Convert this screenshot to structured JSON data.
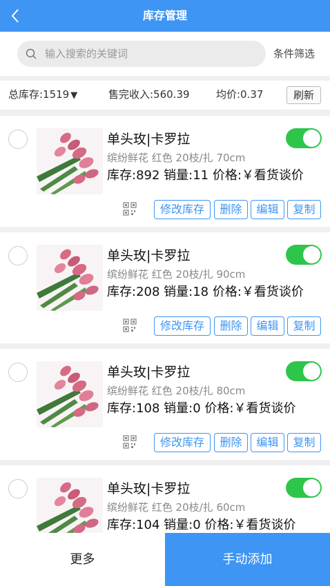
{
  "header": {
    "title": "库存管理",
    "back_icon": "chevron-left-icon"
  },
  "search": {
    "placeholder": "输入搜索的关键词",
    "filter_label": "条件筛选"
  },
  "summary": {
    "total_stock": "总库存:1519",
    "income": "售完收入:560.39",
    "avg_price": "均价:0.37",
    "refresh_label": "刷新"
  },
  "actions": {
    "edit_stock": "修改库存",
    "delete": "删除",
    "edit": "编辑",
    "copy": "复制"
  },
  "items": [
    {
      "name": "单头玫|卡罗拉",
      "attrs": "缤纷鲜花  红色  20枝/扎  70cm",
      "stats": "库存:892 销量:11 价格:￥看货谈价",
      "enabled": true
    },
    {
      "name": "单头玫|卡罗拉",
      "attrs": "缤纷鲜花  红色  20枝/扎  90cm",
      "stats": "库存:208 销量:18 价格:￥看货谈价",
      "enabled": true
    },
    {
      "name": "单头玫|卡罗拉",
      "attrs": "缤纷鲜花  红色  20枝/扎  80cm",
      "stats": "库存:108 销量:0 价格:￥看货谈价",
      "enabled": true
    },
    {
      "name": "单头玫|卡罗拉",
      "attrs": "缤纷鲜花  红色  20枝/扎  60cm",
      "stats": "库存:104 销量:0 价格:￥看货谈价",
      "enabled": true
    }
  ],
  "bottom": {
    "more_label": "更多",
    "add_label": "手动添加"
  },
  "colors": {
    "primary": "#3e95f3",
    "toggle_on": "#2ec64a"
  }
}
